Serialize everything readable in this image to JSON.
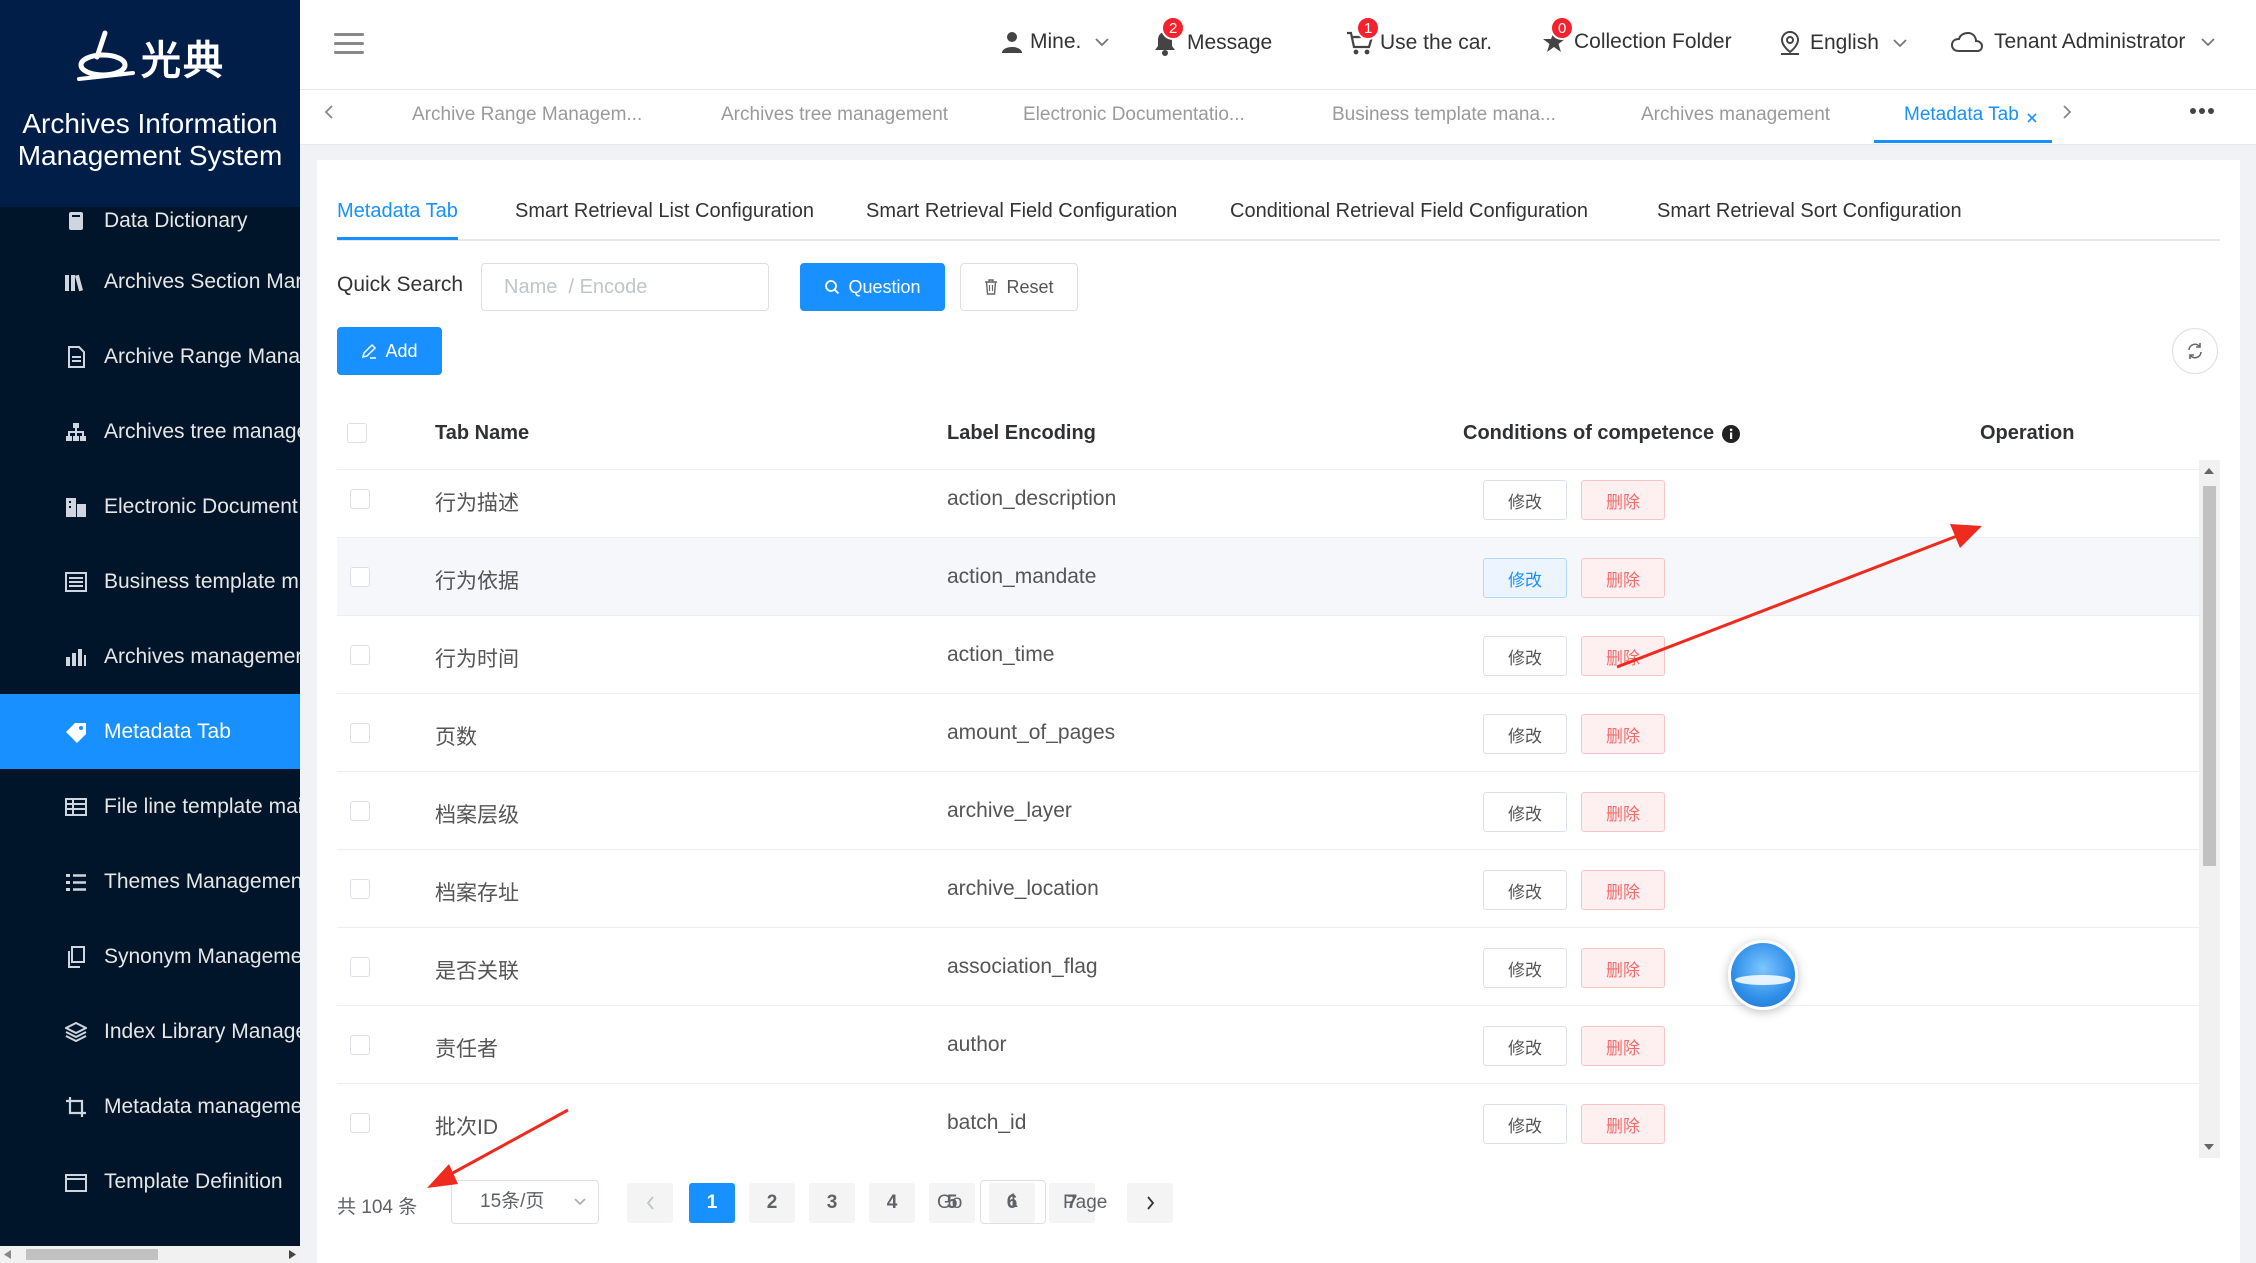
{
  "app": {
    "logo_text": "光典",
    "system_title_line1": "Archives Information",
    "system_title_line2": "Management System"
  },
  "sidebar": {
    "items": [
      {
        "label": "Data Dictionary",
        "icon": "book-icon"
      },
      {
        "label": "Archives Section Mar",
        "icon": "books-icon"
      },
      {
        "label": "Archive Range Mana",
        "icon": "document-icon"
      },
      {
        "label": "Archives tree manage",
        "icon": "tree-icon"
      },
      {
        "label": "Electronic Document",
        "icon": "building-icon"
      },
      {
        "label": "Business template m",
        "icon": "template-icon"
      },
      {
        "label": "Archives managemer",
        "icon": "chart-icon"
      },
      {
        "label": "Metadata Tab",
        "icon": "tag-icon",
        "active": true
      },
      {
        "label": "File line template mai",
        "icon": "table-icon"
      },
      {
        "label": "Themes Managemen",
        "icon": "list-icon"
      },
      {
        "label": "Synonym Manageme",
        "icon": "copy-icon"
      },
      {
        "label": "Index Library Manage",
        "icon": "layers-icon"
      },
      {
        "label": "Metadata manageme",
        "icon": "crop-icon"
      },
      {
        "label": "Template Definition",
        "icon": "window-icon"
      }
    ]
  },
  "header": {
    "user_label": "Mine.",
    "message_label": "Message",
    "message_count": "2",
    "cart_label": "Use the car.",
    "cart_count": "1",
    "collection_label": "Collection Folder",
    "collection_count": "0",
    "language_label": "English",
    "tenant_label": "Tenant Administrator"
  },
  "tags": [
    {
      "label": "Archive Range Managem..."
    },
    {
      "label": "Archives tree management"
    },
    {
      "label": "Electronic Documentatio..."
    },
    {
      "label": "Business template mana..."
    },
    {
      "label": "Archives management"
    },
    {
      "label": "Metadata Tab",
      "active": true
    }
  ],
  "subtabs": [
    {
      "label": "Metadata Tab",
      "active": true
    },
    {
      "label": "Smart Retrieval List Configuration"
    },
    {
      "label": "Smart Retrieval Field Configuration"
    },
    {
      "label": "Conditional Retrieval Field Configuration"
    },
    {
      "label": "Smart Retrieval Sort Configuration"
    }
  ],
  "search": {
    "label": "Quick Search",
    "placeholder": "Name  / Encode",
    "query_button": "Question",
    "reset_button": "Reset",
    "add_button": "Add"
  },
  "table": {
    "columns": [
      "Tab Name",
      "Label Encoding",
      "Conditions of competence",
      "Operation"
    ],
    "edit_label": "修改",
    "delete_label": "删除",
    "rows": [
      {
        "name": "行为描述",
        "code": "action_description"
      },
      {
        "name": "行为依据",
        "code": "action_mandate",
        "hover": true
      },
      {
        "name": "行为时间",
        "code": "action_time"
      },
      {
        "name": "页数",
        "code": "amount_of_pages"
      },
      {
        "name": "档案层级",
        "code": "archive_layer"
      },
      {
        "name": "档案存址",
        "code": "archive_location"
      },
      {
        "name": "是否关联",
        "code": "association_flag"
      },
      {
        "name": "责任者",
        "code": "author"
      },
      {
        "name": "批次ID",
        "code": "batch_id"
      }
    ]
  },
  "pagination": {
    "total_text": "共 104 条",
    "page_size": "15条/页",
    "pages": [
      "1",
      "2",
      "3",
      "4",
      "5",
      "6",
      "7"
    ],
    "current": "1",
    "go_label": "Go",
    "go_value": "1",
    "page_label": "Page"
  },
  "colors": {
    "accent": "#1890ff",
    "sidebar_bg": "#001529",
    "danger": "#f56c6c",
    "annotation_arrow": "#ee2b1e"
  }
}
